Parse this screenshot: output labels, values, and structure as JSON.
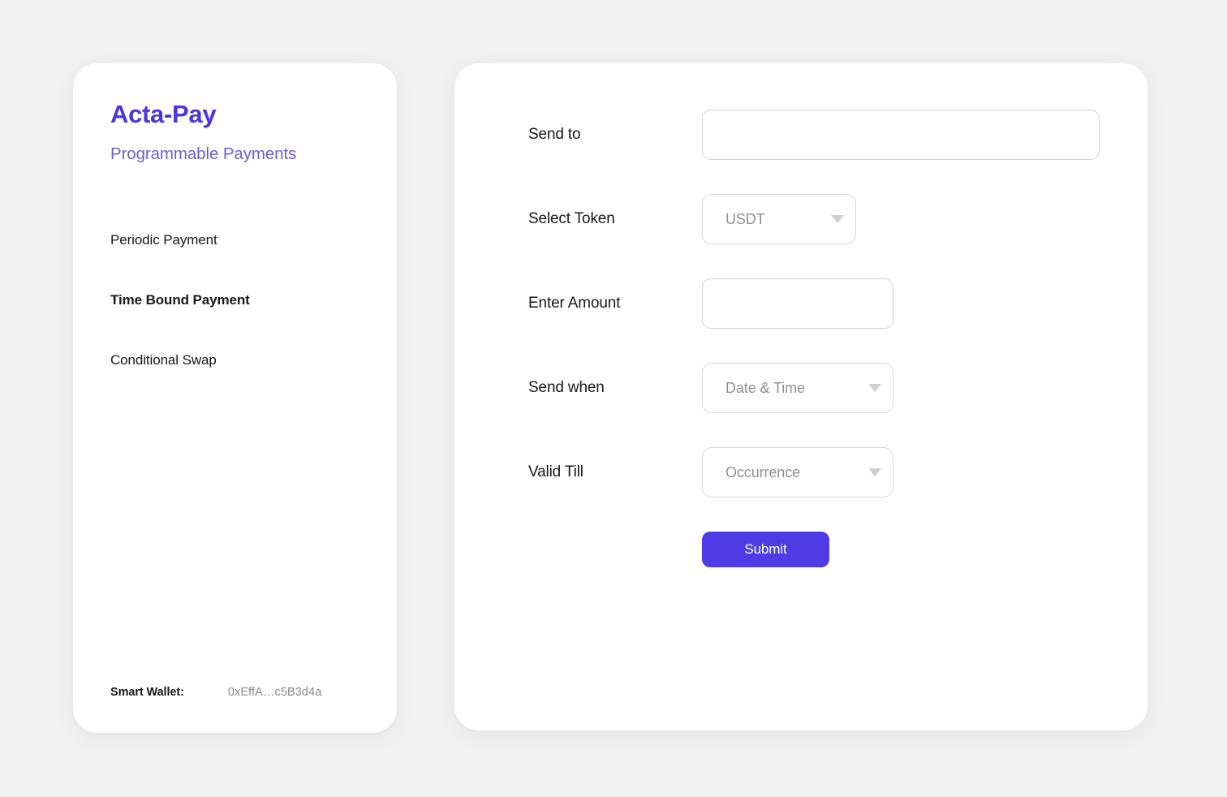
{
  "brand": {
    "title": "Acta-Pay",
    "subtitle": "Programmable Payments",
    "title_color": "#4c35e0",
    "subtitle_color": "#6a5ed0"
  },
  "sidebar": {
    "items": [
      {
        "label": "Periodic Payment",
        "active": false
      },
      {
        "label": "Time Bound Payment",
        "active": true
      },
      {
        "label": "Conditional Swap",
        "active": false
      }
    ],
    "wallet": {
      "label": "Smart Wallet:",
      "address": "0xEffA…c5B3d4a"
    }
  },
  "form": {
    "fields": [
      {
        "label": "Send to",
        "type": "input",
        "value": "",
        "placeholder": ""
      },
      {
        "label": "Select Token",
        "type": "select",
        "value": "USDT"
      },
      {
        "label": "Enter Amount",
        "type": "input",
        "value": "",
        "placeholder": ""
      },
      {
        "label": "Send when",
        "type": "select",
        "value": "Date & Time"
      },
      {
        "label": "Valid Till",
        "type": "select",
        "value": "Occurrence"
      }
    ],
    "submit_label": "Submit",
    "accent_color": "#4f3ce6"
  }
}
